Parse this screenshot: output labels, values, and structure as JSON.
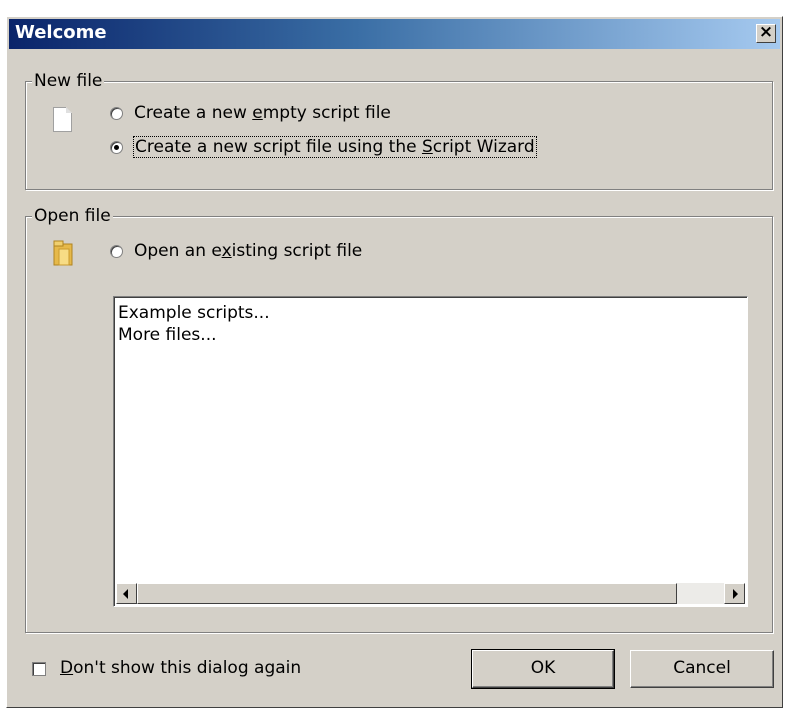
{
  "window": {
    "title": "Welcome",
    "close_label": "×"
  },
  "new_file": {
    "legend": "New file",
    "icon": "blank-document-icon",
    "options": [
      {
        "pre": "Create a new ",
        "access": "e",
        "post": "mpty script file",
        "checked": false
      },
      {
        "pre": "Create a new script file using the ",
        "access": "S",
        "post": "cript Wizard",
        "checked": true
      }
    ]
  },
  "open_file": {
    "legend": "Open file",
    "icon": "folder-icon",
    "option": {
      "pre": "Open an e",
      "access": "x",
      "post": "isting script file",
      "checked": false
    },
    "list_items": [
      "Example scripts...",
      "More files..."
    ]
  },
  "footer": {
    "dont_show": {
      "access": "D",
      "post": "on't show this dialog again",
      "checked": false
    },
    "ok_label": "OK",
    "cancel_label": "Cancel"
  },
  "colors": {
    "dialog_face": "#d4d0c8",
    "title_start": "#0a246a",
    "title_end": "#a6caf0"
  }
}
